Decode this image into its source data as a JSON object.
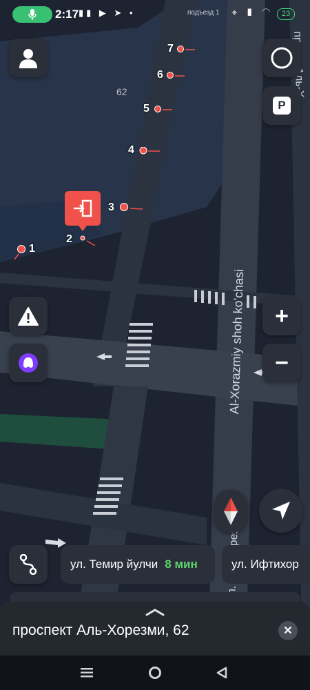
{
  "status_bar": {
    "time": "2:17",
    "left_icons": "▮▮ ▶ ➤ •",
    "entrance": "подъезд 1",
    "right_icons": "⌖ ▮ ◠",
    "battery": "23"
  },
  "map": {
    "building_number": "62",
    "street_vertical_uz": "Al-Xorazmiy shoh ko'chasi",
    "street_vertical_ru": "ул. Аль-Хорезми",
    "street_top_right": "просп. Аль-Х",
    "entrances": [
      "1",
      "2",
      "3",
      "4",
      "5",
      "6",
      "7"
    ]
  },
  "route": {
    "card1_street": "ул. Темир йулчи",
    "card1_time": "8 мин",
    "card2_street": "ул. Ифтихор"
  },
  "bottom_sheet": {
    "address": "проспект Аль-Хорезми, 62"
  },
  "icons": {
    "profile": "profile-icon",
    "alert": "alert-icon",
    "alice": "alice-assistant-icon",
    "layers": "layers-icon",
    "parking": "P",
    "zoom_in": "+",
    "zoom_out": "−",
    "compass": "compass-icon",
    "locate": "locate-icon",
    "route_options": "route-options-icon",
    "close": "✕"
  },
  "colors": {
    "accent_red": "#f0514a",
    "eta_green": "#5fd46c",
    "alice_purple": "#7f3cff"
  }
}
